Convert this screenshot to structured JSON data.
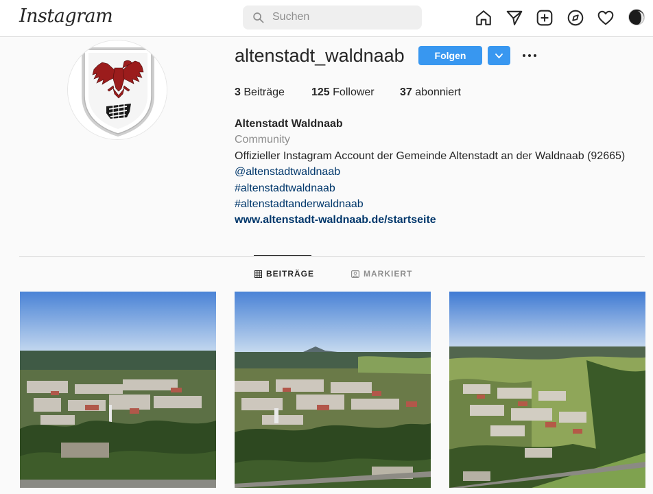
{
  "nav": {
    "logo": "Instagram",
    "search_placeholder": "Suchen",
    "icons": [
      "home-icon",
      "direct-icon",
      "new-post-icon",
      "explore-icon",
      "activity-icon",
      "avatar"
    ]
  },
  "profile": {
    "username": "altenstadt_waldnaab",
    "follow_label": "Folgen",
    "stats": {
      "posts_count": "3",
      "posts_label": "Beiträge",
      "followers_count": "125",
      "followers_label": "Follower",
      "following_count": "37",
      "following_label": "abonniert"
    },
    "bio": {
      "name": "Altenstadt Waldnaab",
      "category": "Community",
      "description": "Offizieller Instagram Account der Gemeinde Altenstadt an der Waldnaab (92665)",
      "mention": "@altenstadtwaldnaab",
      "hashtag1": "#altenstadtwaldnaab",
      "hashtag2": "#altenstadtanderwaldnaab",
      "website": "www.altenstadt-waldnaab.de/startseite"
    }
  },
  "tabs": {
    "posts": "BEITRÄGE",
    "tagged": "MARKIERT"
  },
  "colors": {
    "accent": "#3897f0",
    "link": "#00376b",
    "muted": "#8e8e8e",
    "eagle": "#9b1c1c"
  },
  "posts": [
    "aerial-photo",
    "aerial-photo",
    "aerial-photo"
  ]
}
